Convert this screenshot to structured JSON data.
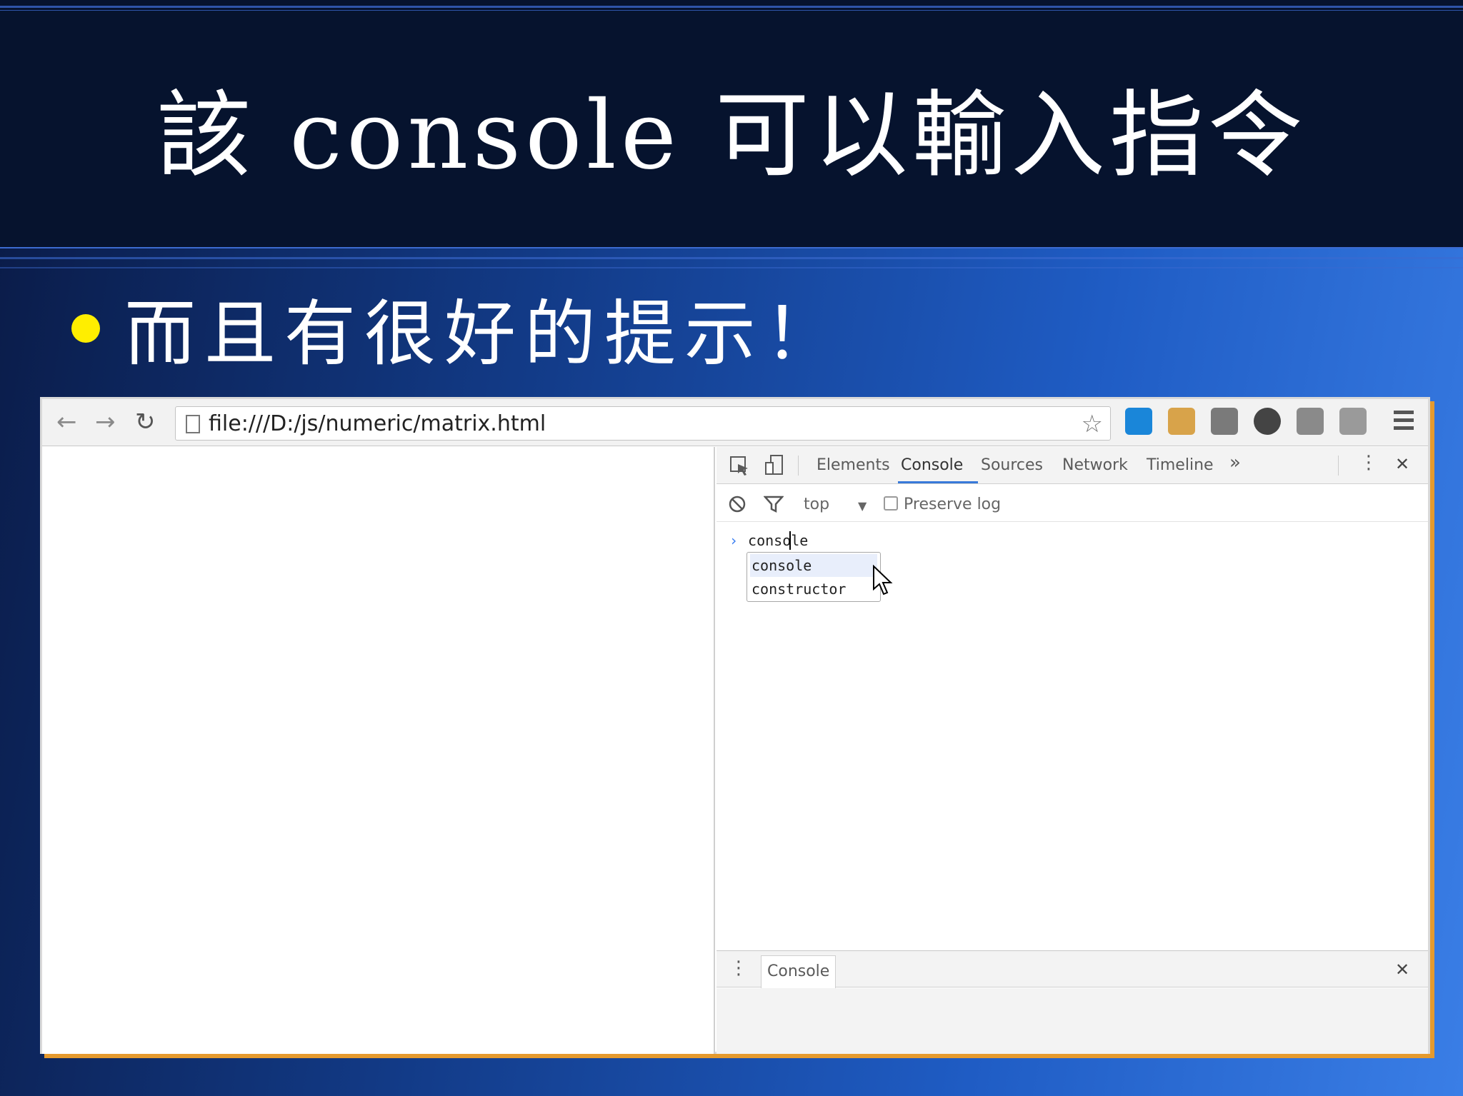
{
  "slide": {
    "title": "該 console 可以輸入指令",
    "bullet": "而且有很好的提示！"
  },
  "browser": {
    "back_icon": "←",
    "forward_icon": "→",
    "reload_icon": "↻",
    "url": "file:///D:/js/numeric/matrix.html",
    "star_icon": "☆",
    "extensions": [
      {
        "name": "vpn-icon",
        "color": "#1a86d9"
      },
      {
        "name": "facebook-ext-icon",
        "color": "#d8a34a"
      },
      {
        "name": "keyboard-ext-icon",
        "color": "#7a7a7a"
      },
      {
        "name": "camera-ext-icon",
        "color": "#444444"
      },
      {
        "name": "dropbox-icon",
        "color": "#8a8a8a"
      },
      {
        "name": "drive-icon",
        "color": "#9a9a9a"
      }
    ]
  },
  "devtools": {
    "tabs": [
      "Elements",
      "Console",
      "Sources",
      "Network",
      "Timeline"
    ],
    "active_tab": "Console",
    "more_icon": "»",
    "kebab_icon": "⋮",
    "close_icon": "✕",
    "filter": {
      "context": "top",
      "dropdown_icon": "▼",
      "preserve_log": "Preserve log"
    },
    "console": {
      "prompt_icon": "›",
      "input": "console",
      "suggestions": [
        "console",
        "constructor"
      ]
    },
    "drawer": {
      "kebab_icon": "⋮",
      "tab": "Console",
      "close_icon": "✕"
    }
  },
  "colors": {
    "bullet": "#ffee00",
    "accent": "#3879d9",
    "frame_shadow": "#e59a2e"
  }
}
